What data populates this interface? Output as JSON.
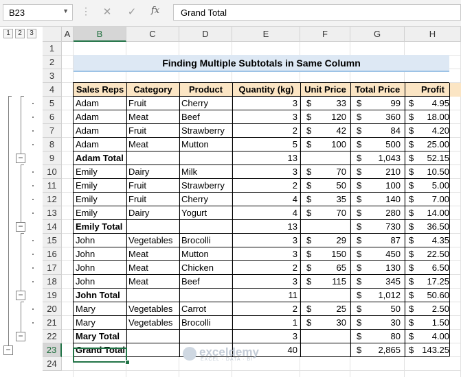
{
  "formula_bar": {
    "name_box": "B23",
    "name_box_dropdown_icon": "chevron-down-icon",
    "cancel_icon": "✕",
    "enter_icon": "✓",
    "fx_label": "fx",
    "formula_value": "Grand Total"
  },
  "outline_levels": [
    "1",
    "2",
    "3"
  ],
  "outline_collapse_symbol": "−",
  "columns": [
    "A",
    "B",
    "C",
    "D",
    "E",
    "F",
    "G",
    "H"
  ],
  "rows": [
    "1",
    "2",
    "3",
    "4",
    "5",
    "6",
    "7",
    "8",
    "9",
    "10",
    "11",
    "12",
    "13",
    "14",
    "15",
    "16",
    "17",
    "18",
    "19",
    "20",
    "21",
    "22",
    "23",
    "24"
  ],
  "sheet_title": "Finding Multiple Subtotals in Same Column",
  "table": {
    "headers": [
      "Sales Reps",
      "Category",
      "Product",
      "Quantity (kg)",
      "Unit Price",
      "Total Price",
      "Profit"
    ],
    "rows": [
      {
        "rep": "Adam",
        "category": "Fruit",
        "product": "Cherry",
        "qty": "3",
        "up_cur": "$",
        "up": "33",
        "tp_cur": "$",
        "tp": "99",
        "pr_cur": "$",
        "pr": "4.95",
        "bold": false
      },
      {
        "rep": "Adam",
        "category": "Meat",
        "product": "Beef",
        "qty": "3",
        "up_cur": "$",
        "up": "120",
        "tp_cur": "$",
        "tp": "360",
        "pr_cur": "$",
        "pr": "18.00",
        "bold": false
      },
      {
        "rep": "Adam",
        "category": "Fruit",
        "product": "Strawberry",
        "qty": "2",
        "up_cur": "$",
        "up": "42",
        "tp_cur": "$",
        "tp": "84",
        "pr_cur": "$",
        "pr": "4.20",
        "bold": false
      },
      {
        "rep": "Adam",
        "category": "Meat",
        "product": "Mutton",
        "qty": "5",
        "up_cur": "$",
        "up": "100",
        "tp_cur": "$",
        "tp": "500",
        "pr_cur": "$",
        "pr": "25.00",
        "bold": false
      },
      {
        "rep": "Adam Total",
        "category": "",
        "product": "",
        "qty": "13",
        "up_cur": "",
        "up": "",
        "tp_cur": "$",
        "tp": "1,043",
        "pr_cur": "$",
        "pr": "52.15",
        "bold": true
      },
      {
        "rep": "Emily",
        "category": "Dairy",
        "product": "Milk",
        "qty": "3",
        "up_cur": "$",
        "up": "70",
        "tp_cur": "$",
        "tp": "210",
        "pr_cur": "$",
        "pr": "10.50",
        "bold": false
      },
      {
        "rep": "Emily",
        "category": "Fruit",
        "product": "Strawberry",
        "qty": "2",
        "up_cur": "$",
        "up": "50",
        "tp_cur": "$",
        "tp": "100",
        "pr_cur": "$",
        "pr": "5.00",
        "bold": false
      },
      {
        "rep": "Emily",
        "category": "Fruit",
        "product": "Cherry",
        "qty": "4",
        "up_cur": "$",
        "up": "35",
        "tp_cur": "$",
        "tp": "140",
        "pr_cur": "$",
        "pr": "7.00",
        "bold": false
      },
      {
        "rep": "Emily",
        "category": "Dairy",
        "product": "Yogurt",
        "qty": "4",
        "up_cur": "$",
        "up": "70",
        "tp_cur": "$",
        "tp": "280",
        "pr_cur": "$",
        "pr": "14.00",
        "bold": false
      },
      {
        "rep": "Emily Total",
        "category": "",
        "product": "",
        "qty": "13",
        "up_cur": "",
        "up": "",
        "tp_cur": "$",
        "tp": "730",
        "pr_cur": "$",
        "pr": "36.50",
        "bold": true
      },
      {
        "rep": "John",
        "category": "Vegetables",
        "product": "Brocolli",
        "qty": "3",
        "up_cur": "$",
        "up": "29",
        "tp_cur": "$",
        "tp": "87",
        "pr_cur": "$",
        "pr": "4.35",
        "bold": false
      },
      {
        "rep": "John",
        "category": "Meat",
        "product": "Mutton",
        "qty": "3",
        "up_cur": "$",
        "up": "150",
        "tp_cur": "$",
        "tp": "450",
        "pr_cur": "$",
        "pr": "22.50",
        "bold": false
      },
      {
        "rep": "John",
        "category": "Meat",
        "product": "Chicken",
        "qty": "2",
        "up_cur": "$",
        "up": "65",
        "tp_cur": "$",
        "tp": "130",
        "pr_cur": "$",
        "pr": "6.50",
        "bold": false
      },
      {
        "rep": "John",
        "category": "Meat",
        "product": "Beef",
        "qty": "3",
        "up_cur": "$",
        "up": "115",
        "tp_cur": "$",
        "tp": "345",
        "pr_cur": "$",
        "pr": "17.25",
        "bold": false
      },
      {
        "rep": "John Total",
        "category": "",
        "product": "",
        "qty": "11",
        "up_cur": "",
        "up": "",
        "tp_cur": "$",
        "tp": "1,012",
        "pr_cur": "$",
        "pr": "50.60",
        "bold": true
      },
      {
        "rep": "Mary",
        "category": "Vegetables",
        "product": "Carrot",
        "qty": "2",
        "up_cur": "$",
        "up": "25",
        "tp_cur": "$",
        "tp": "50",
        "pr_cur": "$",
        "pr": "2.50",
        "bold": false
      },
      {
        "rep": "Mary",
        "category": "Vegetables",
        "product": "Brocolli",
        "qty": "1",
        "up_cur": "$",
        "up": "30",
        "tp_cur": "$",
        "tp": "30",
        "pr_cur": "$",
        "pr": "1.50",
        "bold": false
      },
      {
        "rep": "Mary Total",
        "category": "",
        "product": "",
        "qty": "3",
        "up_cur": "",
        "up": "",
        "tp_cur": "$",
        "tp": "80",
        "pr_cur": "$",
        "pr": "4.00",
        "bold": true
      },
      {
        "rep": "Grand Total",
        "category": "",
        "product": "",
        "qty": "40",
        "up_cur": "",
        "up": "",
        "tp_cur": "$",
        "tp": "2,865",
        "pr_cur": "$",
        "pr": "143.25",
        "bold": true
      }
    ]
  },
  "watermark": {
    "text": "exceldemy",
    "sub": "EXCEL · DATA · BI"
  },
  "colors": {
    "accent": "#217346",
    "header_fill": "#fbe5c4",
    "title_fill": "#dde8f4"
  }
}
